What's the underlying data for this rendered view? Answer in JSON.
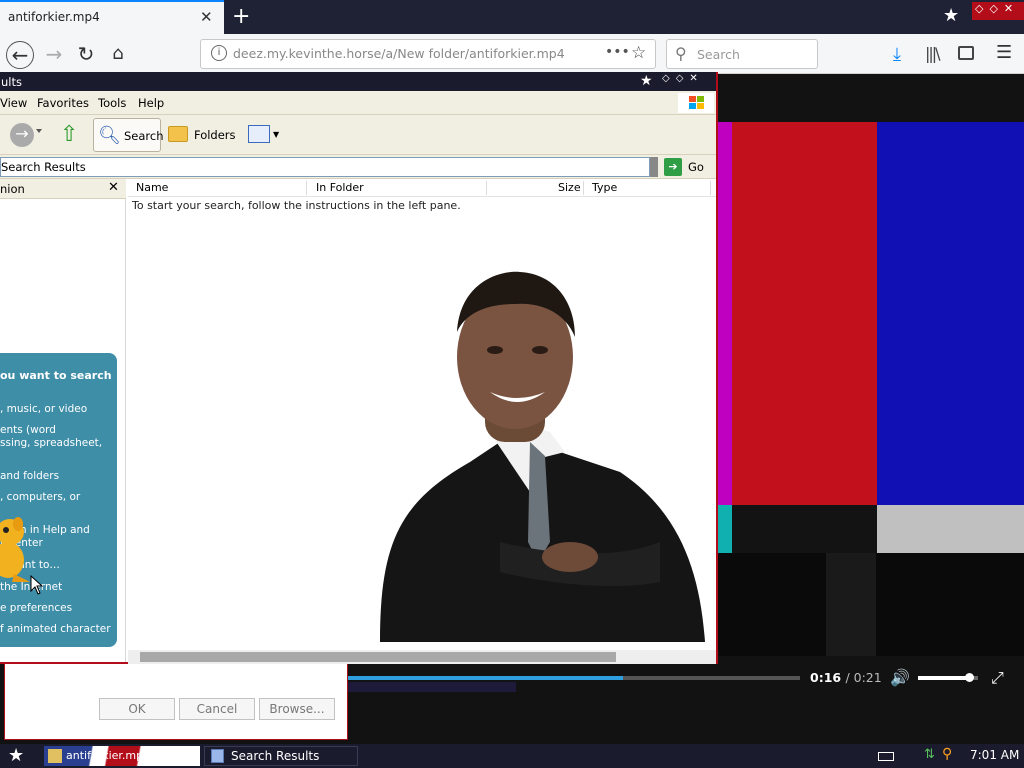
{
  "browser": {
    "tab_title": "antiforkier.mp4",
    "url": "deez.my.kevinthe.horse/a/New folder/antiforkier.mp4",
    "search_placeholder": "Search",
    "accent": "#0a84ff"
  },
  "player": {
    "time_current": "0:16",
    "time_total": "/ 0:21",
    "progress": 0.61,
    "volume": 0.85
  },
  "search_window": {
    "title": "ults",
    "menu": [
      "View",
      "Favorites",
      "Tools",
      "Help"
    ],
    "toolbar": {
      "search_label": "Search",
      "folders_label": "Folders"
    },
    "address_value": "Search Results",
    "go_label": "Go",
    "companion_title": "nion",
    "assistant_question": "ou want to search",
    "assistant_options": [
      ", music, or video",
      "ents (word\nssing, spreadsheet,",
      "and folders",
      ", computers, or",
      "ation in Help and\nt Center",
      "o want to…",
      "the Internet",
      "e preferences",
      "f animated character"
    ],
    "columns": [
      "Name",
      "In Folder",
      "Size",
      "Type"
    ],
    "hint": "To start your search, follow the instructions in the left pane."
  },
  "dialog": {
    "ok_label": "OK",
    "cancel_label": "Cancel",
    "browse_label": "Browse..."
  },
  "taskbar": {
    "task1_label": "antiforkier.mp4 — M",
    "task2_label": "Search Results",
    "clock": "7:01 AM"
  },
  "colors": {
    "wm_red": "#b30d1a",
    "assistant_bg": "#3f8ea8",
    "xp_toolbar": "#f1efe2"
  }
}
